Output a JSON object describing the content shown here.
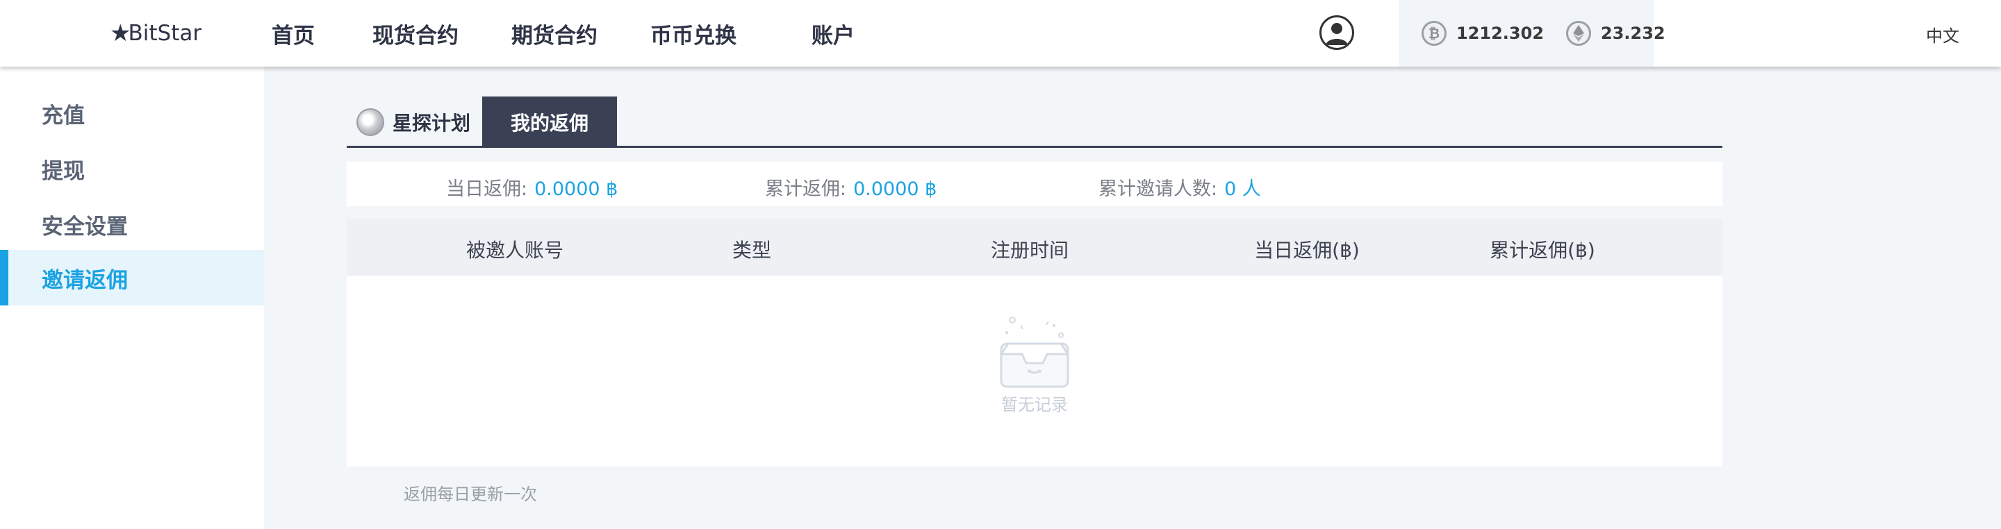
{
  "header": {
    "logo_text": "BitStar",
    "nav": [
      "首页",
      "现货合约",
      "期货合约",
      "币币兑换",
      "账户"
    ],
    "balances": [
      {
        "icon": "bitcoin-icon",
        "value": "1212.302"
      },
      {
        "icon": "ethereum-icon",
        "value": "23.232"
      }
    ],
    "language": "中文"
  },
  "sidebar": {
    "items": [
      "充值",
      "提现",
      "安全设置",
      "邀请返佣"
    ],
    "active_index": 3
  },
  "tabs": {
    "tab1": "星探计划",
    "tab2": "我的返佣"
  },
  "stats": {
    "daily_label": "当日返佣:",
    "daily_value": "0.0000 ฿",
    "total_label": "累计返佣:",
    "total_value": "0.0000 ฿",
    "invites_label": "累计邀请人数:",
    "invites_value": "0 人"
  },
  "table": {
    "columns": [
      "被邀人账号",
      "类型",
      "注册时间",
      "当日返佣(฿)",
      "累计返佣(฿)"
    ],
    "rows": [],
    "empty_text": "暂无记录"
  },
  "footer_note": "返佣每日更新一次",
  "colors": {
    "accent": "#1aa3e3",
    "dark": "#3a4155",
    "background": "#f3f6f9"
  }
}
